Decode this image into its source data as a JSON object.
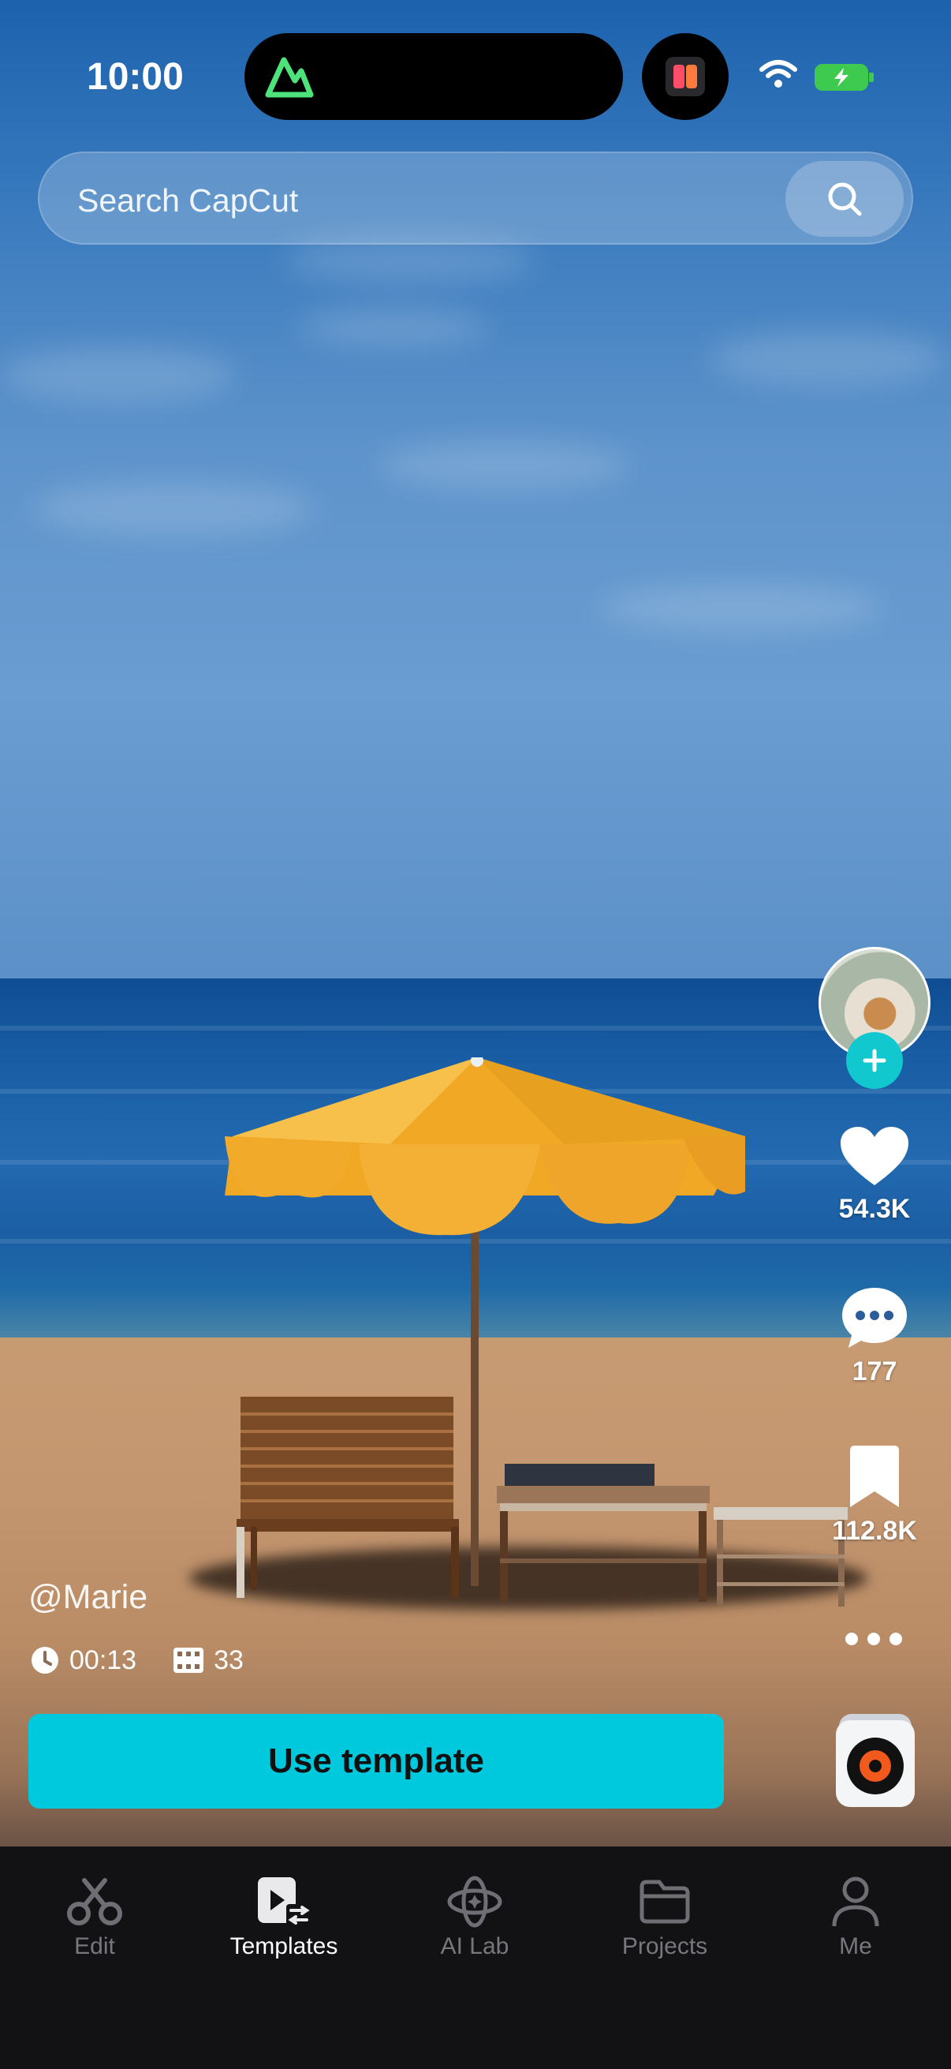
{
  "status_bar": {
    "time": "10:00"
  },
  "search": {
    "placeholder": "Search CapCut"
  },
  "post": {
    "author": "@Marie",
    "duration": "00:13",
    "clips": "33",
    "likes": "54.3K",
    "comments": "177",
    "saves": "112.8K"
  },
  "actions": {
    "use_template": "Use template"
  },
  "tabs": [
    {
      "label": "Edit",
      "icon": "scissors-icon",
      "active": false
    },
    {
      "label": "Templates",
      "icon": "templates-icon",
      "active": true
    },
    {
      "label": "AI Lab",
      "icon": "ai-lab-icon",
      "active": false
    },
    {
      "label": "Projects",
      "icon": "folder-icon",
      "active": false
    },
    {
      "label": "Me",
      "icon": "person-icon",
      "active": false
    }
  ],
  "colors": {
    "accent": "#00c9de",
    "follow": "#12c8cf",
    "tabbar": "#121215"
  }
}
